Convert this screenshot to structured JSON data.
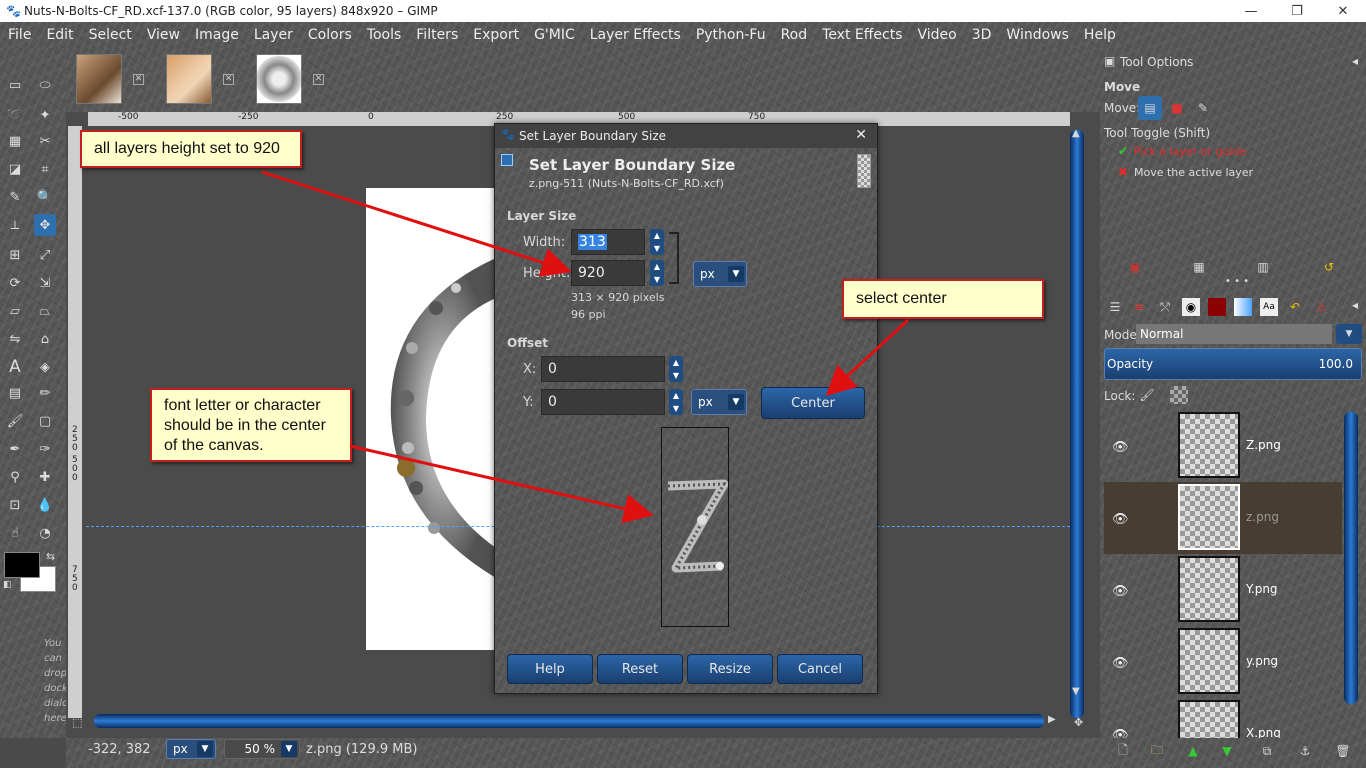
{
  "window": {
    "title": "Nuts-N-Bolts-CF_RD.xcf-137.0 (RGB color, 95 layers) 848x920 – GIMP",
    "controls": [
      "—",
      "❐",
      "✕"
    ]
  },
  "menu": [
    "File",
    "Edit",
    "Select",
    "View",
    "Image",
    "Layer",
    "Colors",
    "Tools",
    "Filters",
    "Export",
    "G'MIC",
    "Layer Effects",
    "Python-Fu",
    "Rod",
    "Text Effects",
    "Video",
    "3D",
    "Windows",
    "Help"
  ],
  "rulers": {
    "h_ticks": [
      "-500",
      "-250",
      "0",
      "250",
      "500",
      "750"
    ],
    "v_ticks": [
      "2",
      "5",
      "0",
      "5",
      "0",
      "0",
      "7",
      "5",
      "0"
    ]
  },
  "statusbar": {
    "coords": "-322, 382",
    "unit": "px",
    "zoom": "50 %",
    "layer_info": "z.png (129.9 MB)"
  },
  "toolbox": {
    "hint": [
      "You",
      "can",
      "drop",
      "docka",
      "dialo",
      "here"
    ]
  },
  "tool_options": {
    "panel_title": "Tool Options",
    "tool_name": "Move",
    "move_label": "Move:",
    "toggle_label": "Tool Toggle  (Shift)",
    "opt1": "Pick a layer or guide",
    "opt2": "Move the active layer"
  },
  "layers_panel": {
    "mode_label": "Mode:",
    "mode_value": "Normal",
    "opacity_label": "Opacity",
    "opacity_value": "100.0",
    "lock_label": "Lock:",
    "layers": [
      {
        "name": "Z.png"
      },
      {
        "name": "z.png"
      },
      {
        "name": "Y.png"
      },
      {
        "name": "y.png"
      },
      {
        "name": "X.png"
      }
    ]
  },
  "dialog": {
    "window_title": "Set Layer Boundary Size",
    "heading": "Set Layer Boundary Size",
    "subheading": "z.png-511 (Nuts-N-Bolts-CF_RD.xcf)",
    "layer_size_label": "Layer Size",
    "width_label": "Width:",
    "width_value": "313",
    "height_label": "Height:",
    "height_value": "920",
    "unit": "px",
    "dims_text": "313 × 920 pixels",
    "ppi_text": "96 ppi",
    "offset_label": "Offset",
    "x_label": "X:",
    "x_value": "0",
    "y_label": "Y:",
    "y_value": "0",
    "center_button": "Center",
    "buttons": {
      "help": "Help",
      "reset": "Reset",
      "resize": "Resize",
      "cancel": "Cancel"
    }
  },
  "annotations": {
    "height_note": "all layers height set to 920",
    "center_note": "select center",
    "font_note_1": "font letter or character",
    "font_note_2": "should be in the center",
    "font_note_3": "of the canvas."
  },
  "colors": {
    "accent": "#2e6fb0",
    "callout_border": "#c61e1e",
    "callout_fill": "#ffffcc",
    "arrow": "#e01010"
  }
}
